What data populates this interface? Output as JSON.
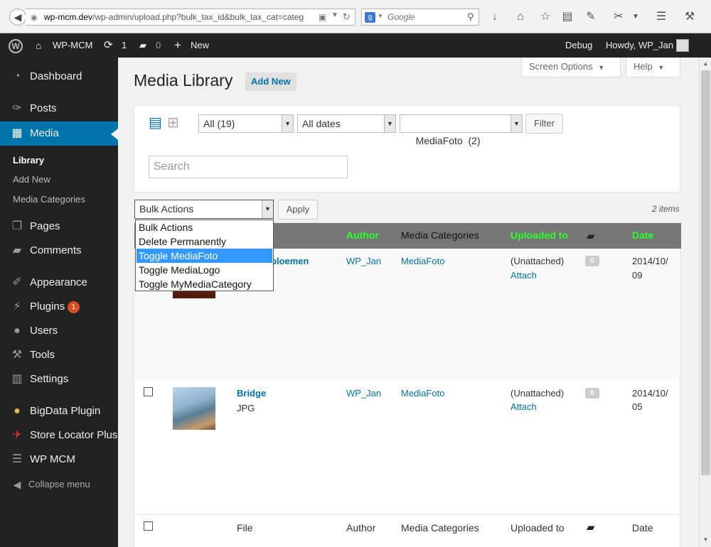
{
  "browser": {
    "url_domain": "wp-mcm.dev",
    "url_path": "/wp-admin/upload.php?bulk_tax_id&bulk_tax_cat=categ",
    "search_placeholder": "Google"
  },
  "adminbar": {
    "site_name": "WP-MCM",
    "updates_count": "1",
    "comments_count": "0",
    "new_label": "New",
    "debug_label": "Debug",
    "howdy_label": "Howdy, WP_Jan"
  },
  "sidebar": {
    "items": [
      {
        "label": "Dashboard",
        "icon": "dashboard-icon"
      },
      {
        "label": "Posts",
        "icon": "pin-icon"
      },
      {
        "label": "Media",
        "icon": "media-icon"
      },
      {
        "label": "Pages",
        "icon": "pages-icon"
      },
      {
        "label": "Comments",
        "icon": "comments-icon"
      },
      {
        "label": "Appearance",
        "icon": "brush-icon"
      },
      {
        "label": "Plugins",
        "icon": "plug-icon",
        "badge": "1"
      },
      {
        "label": "Users",
        "icon": "user-icon"
      },
      {
        "label": "Tools",
        "icon": "wrench-icon"
      },
      {
        "label": "Settings",
        "icon": "settings-icon"
      },
      {
        "label": "BigData Plugin",
        "icon": "lightbulb-icon"
      },
      {
        "label": "Store Locator Plus",
        "icon": "map-icon"
      },
      {
        "label": "WP MCM",
        "icon": "list-icon"
      }
    ],
    "submenu": [
      "Library",
      "Add New",
      "Media Categories"
    ],
    "collapse_label": "Collapse menu"
  },
  "page": {
    "title": "Media Library",
    "add_new_label": "Add New",
    "screen_options_label": "Screen Options",
    "help_label": "Help"
  },
  "filters": {
    "type_value": "All (19)",
    "dates_value": "All dates",
    "category_value": "MediaFoto  (2)",
    "filter_button": "Filter",
    "search_placeholder": "Search"
  },
  "bulk": {
    "selected": "Bulk Actions",
    "apply_label": "Apply",
    "items_count": "2 items",
    "options": [
      "Bulk Actions",
      "Delete Permanently",
      "Toggle MediaFoto",
      "Toggle MediaLogo",
      "Toggle MyMediaCategory"
    ],
    "highlighted_index": 2
  },
  "table": {
    "header": {
      "author": "Author",
      "categories": "Media Categories",
      "uploaded": "Uploaded to",
      "date": "Date"
    },
    "footer": {
      "file": "File",
      "author": "Author",
      "categories": "Media Categories",
      "uploaded": "Uploaded to",
      "date": "Date"
    },
    "rows": [
      {
        "title": "bloemen",
        "type": "",
        "author": "WP_Jan",
        "category": "MediaFoto",
        "uploaded": "(Unattached)",
        "attach": "Attach",
        "comments": "0",
        "date_line1": "2014/10/",
        "date_line2": "09"
      },
      {
        "title": "Bridge",
        "type": "JPG",
        "author": "WP_Jan",
        "category": "MediaFoto",
        "uploaded": "(Unattached)",
        "attach": "Attach",
        "comments": "0",
        "date_line1": "2014/10/",
        "date_line2": "05"
      }
    ]
  },
  "colors": {
    "accent": "#0073aa",
    "highlight_header": "#2bff2b",
    "adminbar": "#222222"
  }
}
